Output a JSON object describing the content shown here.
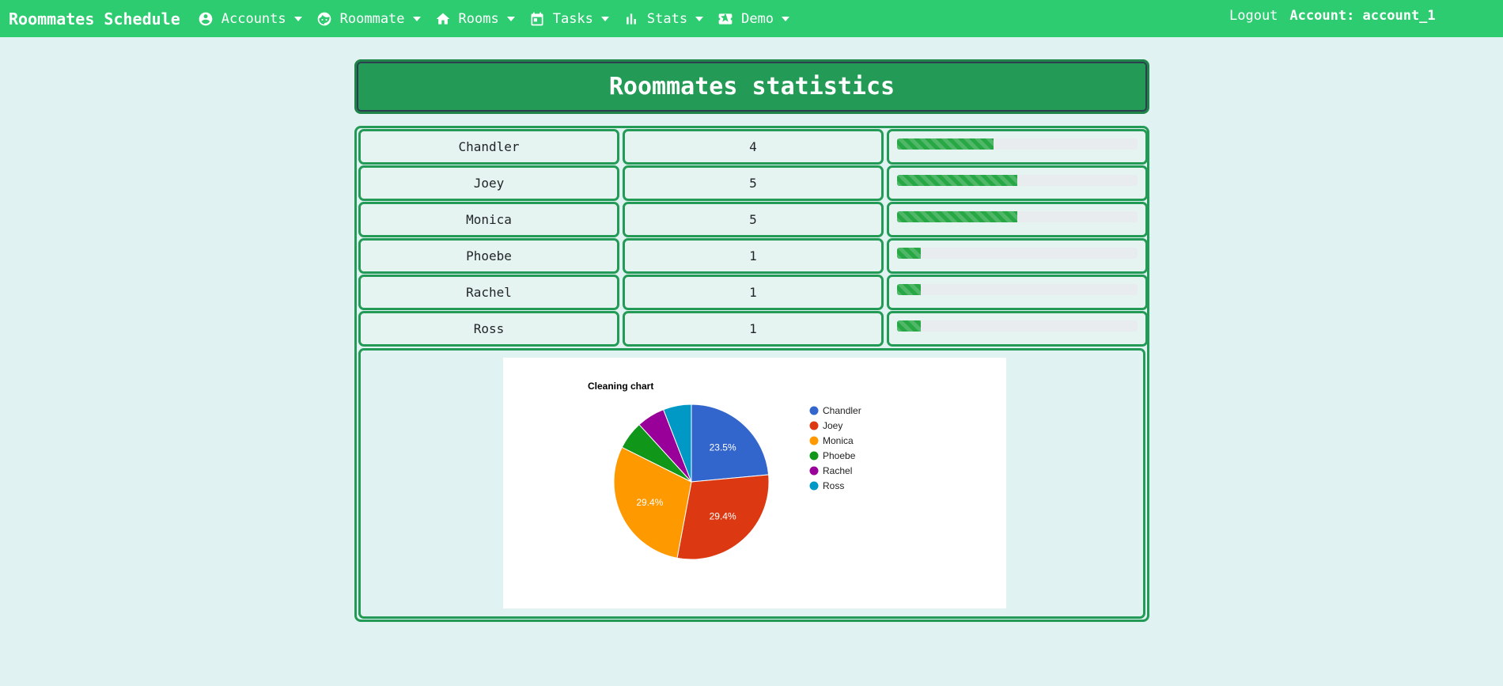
{
  "nav": {
    "brand": "Roommates Schedule",
    "items": [
      {
        "label": "Accounts",
        "icon": "account-circle-icon"
      },
      {
        "label": "Roommate",
        "icon": "face-icon"
      },
      {
        "label": "Rooms",
        "icon": "home-icon"
      },
      {
        "label": "Tasks",
        "icon": "calendar-icon"
      },
      {
        "label": "Stats",
        "icon": "bar-chart-icon"
      },
      {
        "label": "Demo",
        "icon": "ticket-icon"
      }
    ],
    "logout": "Logout",
    "account": "Account: account_1"
  },
  "page": {
    "title": "Roommates statistics"
  },
  "stats": [
    {
      "name": "Chandler",
      "count": "4",
      "fraction": 0.4
    },
    {
      "name": "Joey",
      "count": "5",
      "fraction": 0.5
    },
    {
      "name": "Monica",
      "count": "5",
      "fraction": 0.5
    },
    {
      "name": "Phoebe",
      "count": "1",
      "fraction": 0.1
    },
    {
      "name": "Rachel",
      "count": "1",
      "fraction": 0.1
    },
    {
      "name": "Ross",
      "count": "1",
      "fraction": 0.1
    }
  ],
  "colors": {
    "navbar": "#2ecc71",
    "title_bg": "#239b56",
    "border": "#239b56",
    "page_bg": "#e0f2f1"
  },
  "chart_data": {
    "type": "pie",
    "title": "Cleaning chart",
    "categories": [
      "Chandler",
      "Joey",
      "Monica",
      "Phoebe",
      "Rachel",
      "Ross"
    ],
    "values": [
      4,
      5,
      5,
      1,
      1,
      1
    ],
    "slice_labels": [
      "23.5%",
      "29.4%",
      "29.4%",
      "",
      "",
      ""
    ],
    "colors": [
      "#3366cc",
      "#dc3912",
      "#ff9900",
      "#109618",
      "#990099",
      "#0099c6"
    ],
    "legend_position": "right"
  }
}
